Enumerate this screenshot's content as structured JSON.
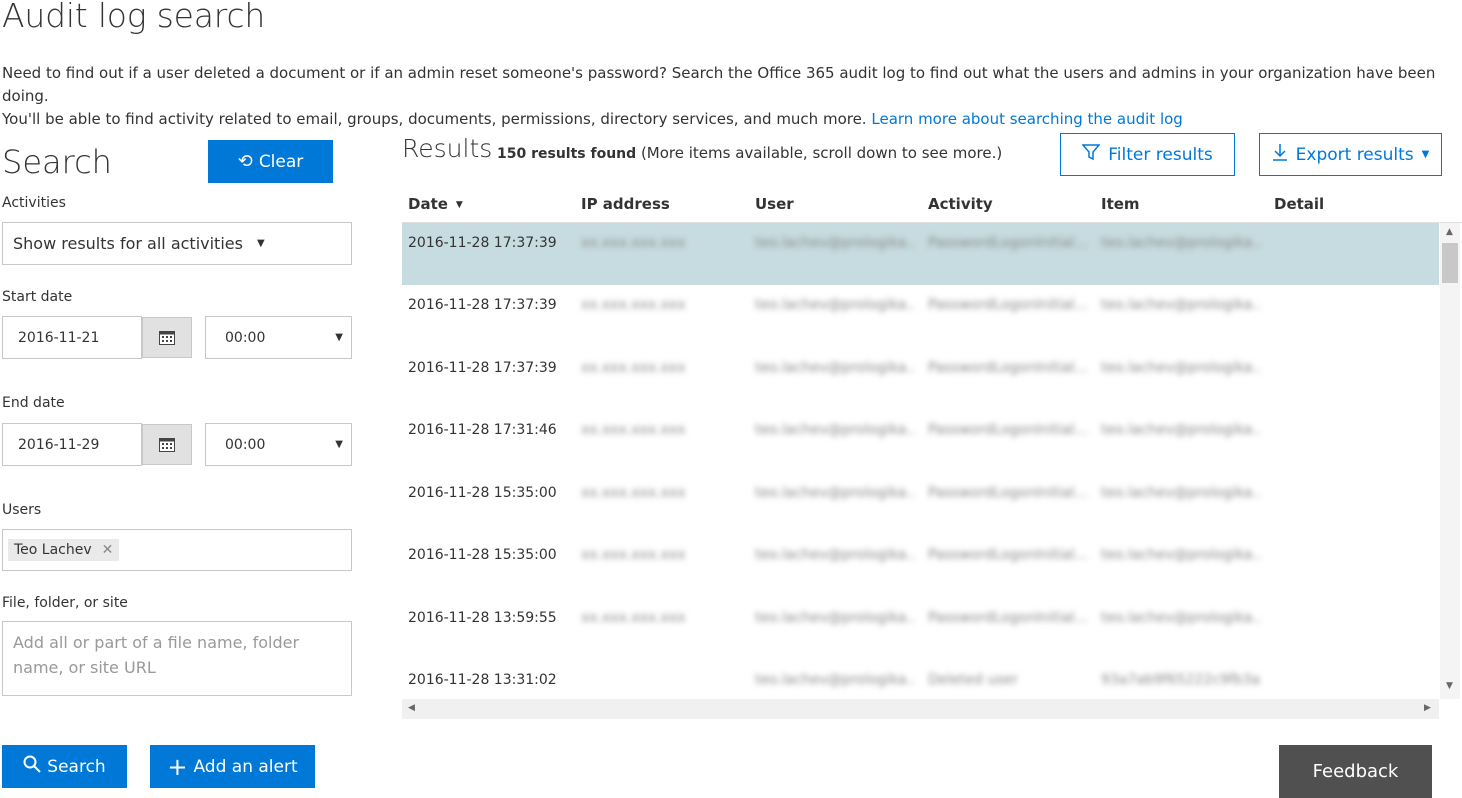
{
  "page": {
    "title": "Audit log search",
    "intro_line1": "Need to find out if a user deleted a document or if an admin reset someone's password? Search the Office 365 audit log to find out what the users and admins in your organization have been doing.",
    "intro_line2": "You'll be able to find activity related to email, groups, documents, permissions, directory services, and much more.",
    "learn_more_link": "Learn more about searching the audit log"
  },
  "search": {
    "heading": "Search",
    "clear_label": "Clear",
    "activities_label": "Activities",
    "activities_value": "Show results for all activities",
    "start_date_label": "Start date",
    "start_date_value": "2016-11-21",
    "start_time_value": "00:00",
    "end_date_label": "End date",
    "end_date_value": "2016-11-29",
    "end_time_value": "00:00",
    "users_label": "Users",
    "users_tags": [
      "Teo Lachev"
    ],
    "file_label": "File, folder, or site",
    "file_placeholder": "Add all or part of a file name, folder name, or site URL",
    "search_button": "Search",
    "add_alert_button": "Add an alert"
  },
  "results": {
    "heading": "Results",
    "count_bold": "150 results found",
    "count_note": "(More items available, scroll down to see more.)",
    "filter_button": "Filter results",
    "export_button": "Export results",
    "columns": [
      "Date",
      "IP address",
      "User",
      "Activity",
      "Item",
      "Detail"
    ],
    "rows": [
      {
        "date": "2016-11-28 17:37:39",
        "ip": "xx.xxx.xxx.xxx",
        "user": "teo.lachev@prologika...",
        "activity": "PasswordLogonInitial...",
        "item": "teo.lachev@prologika..."
      },
      {
        "date": "2016-11-28 17:37:39",
        "ip": "xx.xxx.xxx.xxx",
        "user": "teo.lachev@prologika...",
        "activity": "PasswordLogonInitial...",
        "item": "teo.lachev@prologika..."
      },
      {
        "date": "2016-11-28 17:37:39",
        "ip": "xx.xxx.xxx.xxx",
        "user": "teo.lachev@prologika...",
        "activity": "PasswordLogonInitial...",
        "item": "teo.lachev@prologika..."
      },
      {
        "date": "2016-11-28 17:31:46",
        "ip": "xx.xxx.xxx.xxx",
        "user": "teo.lachev@prologika...",
        "activity": "PasswordLogonInitial...",
        "item": "teo.lachev@prologika..."
      },
      {
        "date": "2016-11-28 15:35:00",
        "ip": "xx.xxx.xxx.xxx",
        "user": "teo.lachev@prologika...",
        "activity": "PasswordLogonInitial...",
        "item": "teo.lachev@prologika..."
      },
      {
        "date": "2016-11-28 15:35:00",
        "ip": "xx.xxx.xxx.xxx",
        "user": "teo.lachev@prologika...",
        "activity": "PasswordLogonInitial...",
        "item": "teo.lachev@prologika..."
      },
      {
        "date": "2016-11-28 13:59:55",
        "ip": "xx.xxx.xxx.xxx",
        "user": "teo.lachev@prologika...",
        "activity": "PasswordLogonInitial...",
        "item": "teo.lachev@prologika..."
      },
      {
        "date": "2016-11-28 13:31:02",
        "ip": "",
        "user": "teo.lachev@prologika...",
        "activity": "Deleted user",
        "item": "93a7ab9f65222c9fb3a..."
      }
    ]
  },
  "feedback_button": "Feedback",
  "colors": {
    "accent": "#0078d7",
    "selected_row": "#c7dce0",
    "feedback_bg": "#505050"
  }
}
